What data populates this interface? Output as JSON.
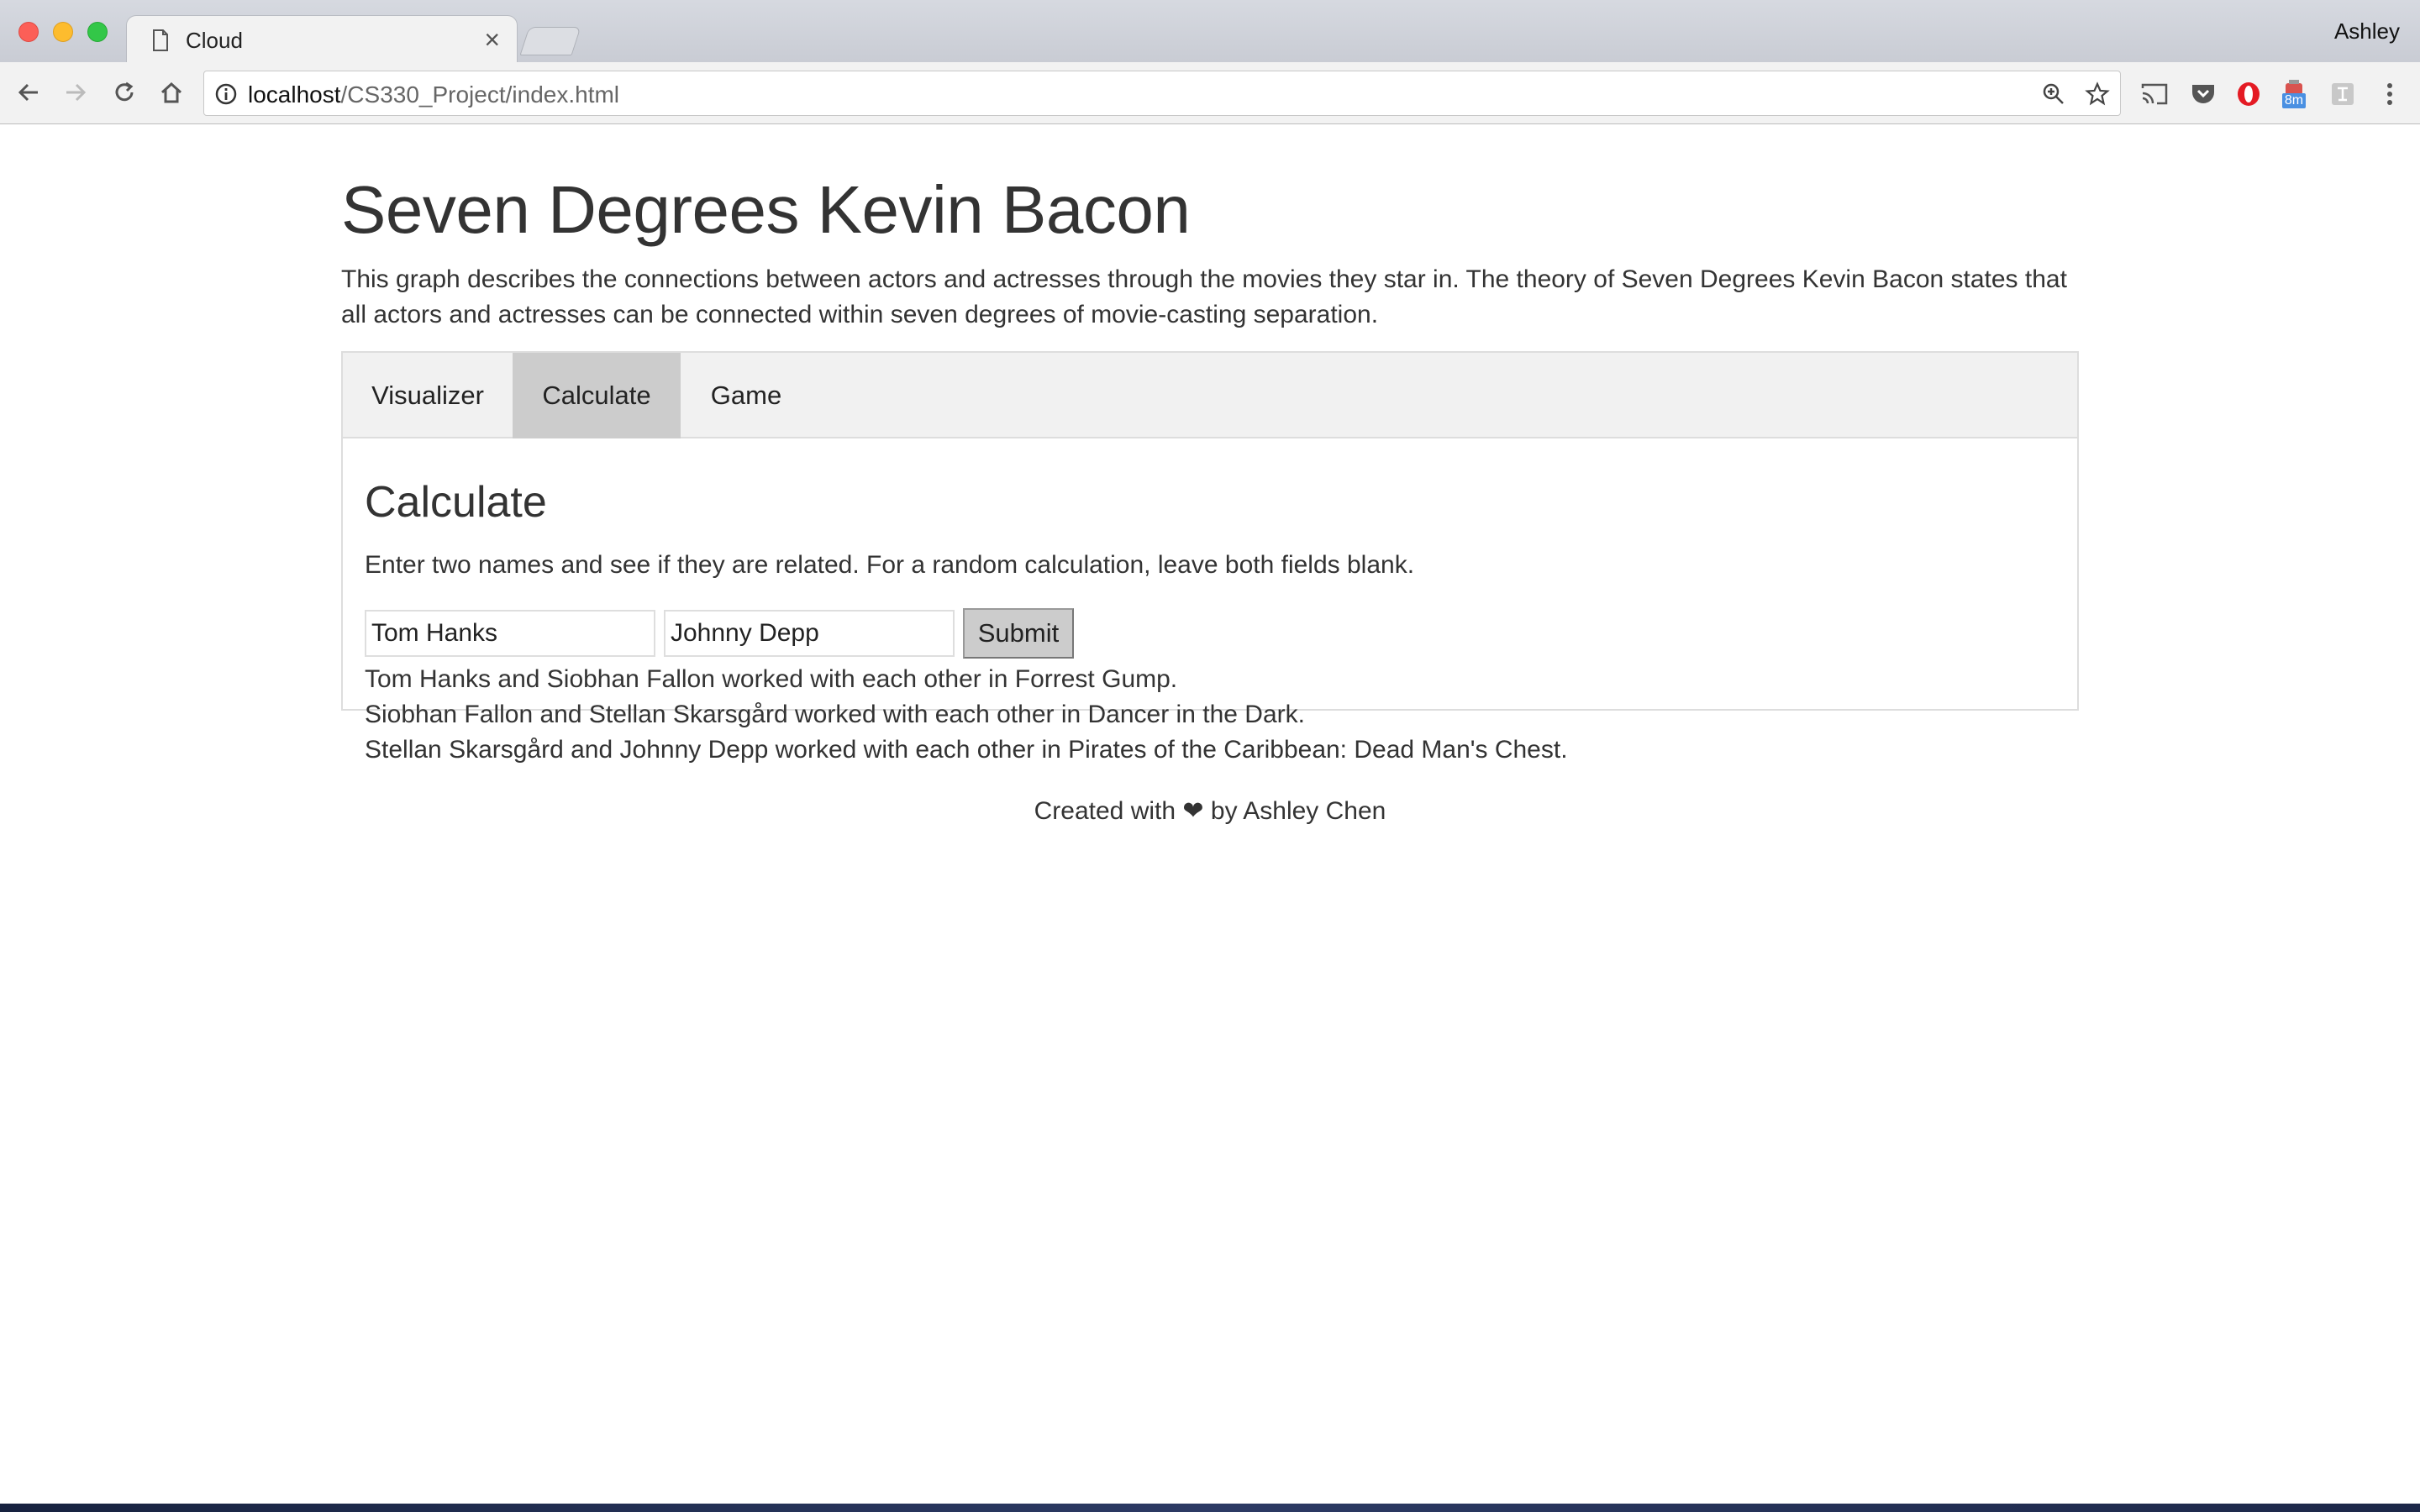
{
  "browser": {
    "tab_title": "Cloud",
    "tab_close": "×",
    "profile_name": "Ashley",
    "url_host": "localhost",
    "url_path": "/CS330_Project/index.html",
    "extension_badge": "8m"
  },
  "page": {
    "title": "Seven Degrees Kevin Bacon",
    "intro": "This graph describes the connections between actors and actresses through the movies they star in. The theory of Seven Degrees Kevin Bacon states that all actors and actresses can be connected within seven degrees of movie-casting separation.",
    "tabs": [
      {
        "label": "Visualizer",
        "active": false
      },
      {
        "label": "Calculate",
        "active": true
      },
      {
        "label": "Game",
        "active": false
      }
    ],
    "calculate": {
      "heading": "Calculate",
      "description": "Enter two names and see if they are related. For a random calculation, leave both fields blank.",
      "name1_value": "Tom Hanks",
      "name2_value": "Johnny Depp",
      "submit_label": "Submit",
      "results": [
        "Tom Hanks and Siobhan Fallon worked with each other in Forrest Gump.",
        "Siobhan Fallon and Stellan Skarsgård worked with each other in Dancer in the Dark.",
        "Stellan Skarsgård and Johnny Depp worked with each other in Pirates of the Caribbean: Dead Man's Chest."
      ]
    },
    "footer": {
      "prefix": "Created with",
      "heart": "❤",
      "suffix": "by Ashley Chen"
    }
  },
  "colors": {
    "active_tab_bg": "#cccccc",
    "tabbar_bg": "#f1f1f1",
    "text": "#333333"
  }
}
